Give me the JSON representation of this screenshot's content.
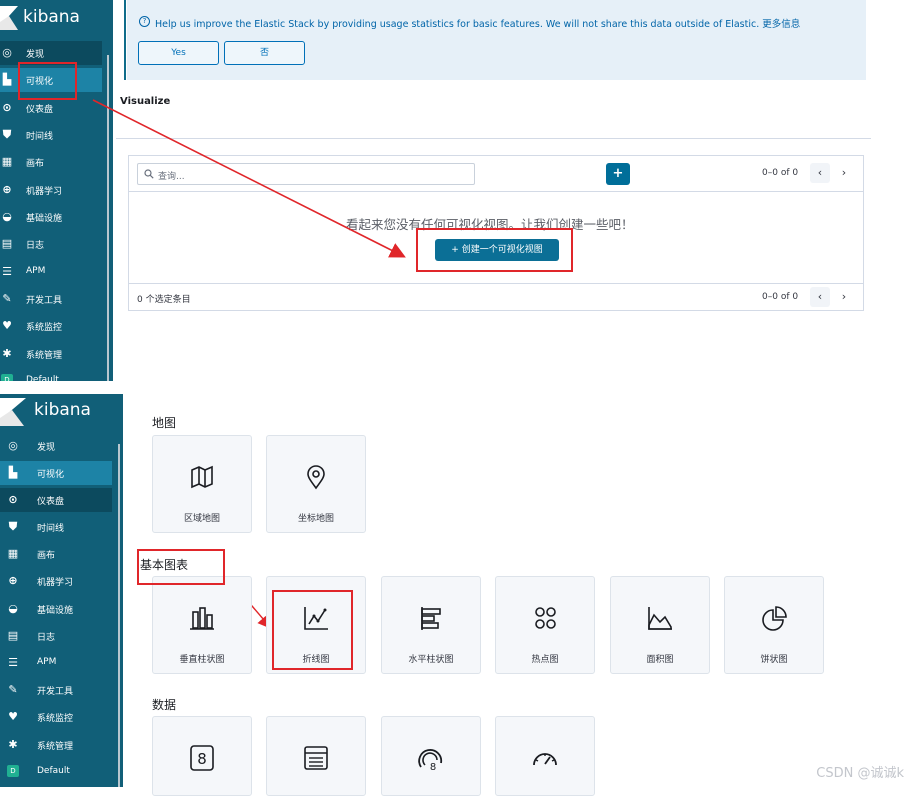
{
  "brand": {
    "name": "kibana",
    "accent": "#115f78",
    "active": "#1d83a6"
  },
  "nav": {
    "items": [
      {
        "label": "发现",
        "icon": "compass-icon"
      },
      {
        "label": "可视化",
        "icon": "bar-chart-icon"
      },
      {
        "label": "仪表盘",
        "icon": "dashboard-icon"
      },
      {
        "label": "时间线",
        "icon": "shield-icon"
      },
      {
        "label": "画布",
        "icon": "canvas-icon"
      },
      {
        "label": "机器学习",
        "icon": "ml-icon"
      },
      {
        "label": "基础设施",
        "icon": "infra-icon"
      },
      {
        "label": "日志",
        "icon": "logs-icon"
      },
      {
        "label": "APM",
        "icon": "apm-icon"
      },
      {
        "label": "开发工具",
        "icon": "wrench-icon"
      },
      {
        "label": "系统监控",
        "icon": "heartbeat-icon"
      },
      {
        "label": "系统管理",
        "icon": "gear-icon"
      },
      {
        "label": "Default",
        "icon": "space-badge-icon",
        "badge": "D"
      }
    ]
  },
  "notice": {
    "text": "Help us improve the Elastic Stack by providing usage statistics for basic features. We will not share this data outside of Elastic. 更多信息",
    "yes_label": "Yes",
    "no_label": "否"
  },
  "page": {
    "title": "Visualize"
  },
  "table": {
    "search_placeholder": "查询...",
    "plus_label": "+",
    "pager_text": "0–0 of 0",
    "prev": "‹",
    "next": "›",
    "empty_message": "看起来您没有任何可视化视图。让我们创建一些吧！",
    "create_label": "+ 创建一个可视化视图",
    "footer_selected": "0 个选定条目"
  },
  "picker": {
    "sections": [
      {
        "title": "地图"
      },
      {
        "title": "基本图表"
      },
      {
        "title": "数据"
      }
    ],
    "maps": [
      {
        "label": "区域地图",
        "icon": "map-icon"
      },
      {
        "label": "坐标地图",
        "icon": "map-pin-icon"
      }
    ],
    "basic": [
      {
        "label": "垂直柱状图",
        "icon": "vertical-bar-icon"
      },
      {
        "label": "折线图",
        "icon": "line-chart-icon"
      },
      {
        "label": "水平柱状图",
        "icon": "horizontal-bar-icon"
      },
      {
        "label": "热点图",
        "icon": "heatmap-icon"
      },
      {
        "label": "面积图",
        "icon": "area-chart-icon"
      },
      {
        "label": "饼状图",
        "icon": "pie-chart-icon"
      }
    ],
    "data": [
      {
        "icon": "metric-icon",
        "glyph": "8"
      },
      {
        "icon": "data-table-icon"
      },
      {
        "icon": "goal-icon"
      },
      {
        "icon": "gauge-icon"
      }
    ]
  },
  "watermark": "CSDN @诚诚k"
}
